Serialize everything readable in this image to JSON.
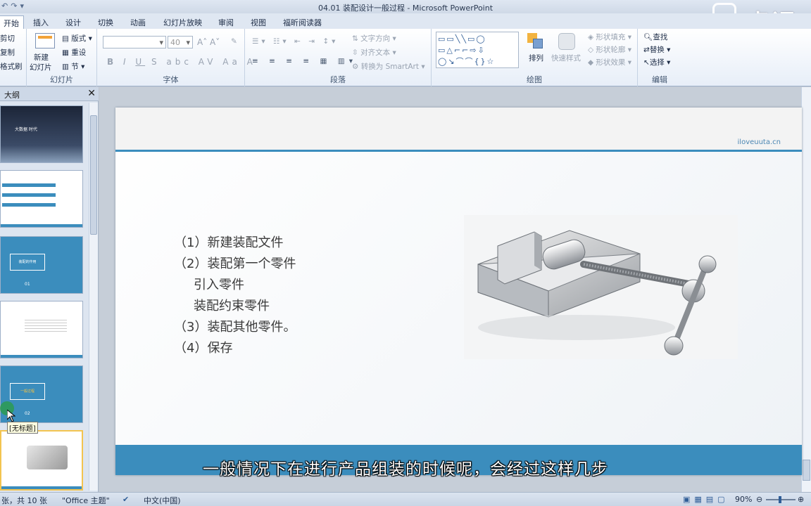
{
  "titlebar": {
    "title": "04.01 装配设计一般过程  -  Microsoft PowerPoint"
  },
  "watermark": {
    "text": "虎课"
  },
  "tabs": [
    {
      "label": "开始",
      "active": true
    },
    {
      "label": "插入"
    },
    {
      "label": "设计"
    },
    {
      "label": "切换"
    },
    {
      "label": "动画"
    },
    {
      "label": "幻灯片放映"
    },
    {
      "label": "审阅"
    },
    {
      "label": "视图"
    },
    {
      "label": "福昕阅读器"
    }
  ],
  "ribbon": {
    "clipboard": {
      "cut": "剪切",
      "copy": "复制",
      "format": "格式刷"
    },
    "slides": {
      "new_line1": "新建",
      "new_line2": "幻灯片",
      "layout": "版式",
      "reset": "重设",
      "section": "节",
      "group": "幻灯片"
    },
    "font": {
      "size": "40",
      "group": "字体"
    },
    "paragraph": {
      "text_direction": "文字方向",
      "align_text": "对齐文本",
      "smartart": "转换为 SmartArt",
      "group": "段落"
    },
    "drawing": {
      "arrange": "排列",
      "quick_styles": "快速样式",
      "fill": "形状填充",
      "outline": "形状轮廓",
      "effects": "形状效果",
      "group": "绘图"
    },
    "editing": {
      "find": "查找",
      "replace": "替换",
      "select": "选择",
      "group": "编辑"
    }
  },
  "leftpane": {
    "tab_label": "大纲",
    "tooltip": "[无标题]",
    "thumbs": [
      {
        "line1": "大数据  时代"
      },
      {
        "line1": ""
      },
      {
        "line1": "装配的作用",
        "num": "01"
      },
      {
        "line1": ""
      },
      {
        "line1": "一般过程",
        "num": "02"
      },
      {
        "line1": ""
      }
    ]
  },
  "slide": {
    "bullets": [
      "（1）新建装配文件",
      "（2）装配第一个零件",
      "引入零件",
      "装配约束零件",
      "（3）装配其他零件。",
      "（4）保存"
    ],
    "header_url": "iloveuuta.cn"
  },
  "subtitle": "一般情况下在进行产品组装的时候呢，会经过这样几步",
  "statusbar": {
    "slide_info": "张，共 10 张",
    "theme": "\"Office 主题\"",
    "language": "中文(中国)",
    "zoom": "90%"
  },
  "colors": {
    "accent": "#3b8dbd"
  }
}
